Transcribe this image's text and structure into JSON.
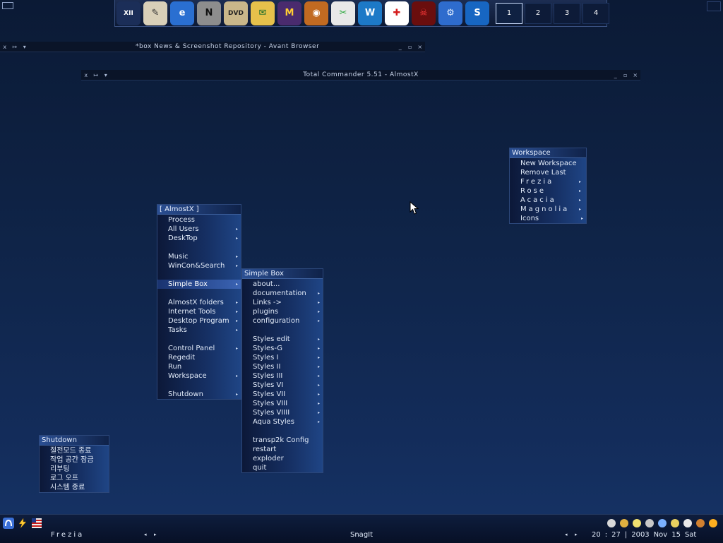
{
  "top_dock": {
    "icons": [
      {
        "name": "clock-icon",
        "glyph": "XII",
        "bg": "#1b2e58",
        "fg": "#ffffff"
      },
      {
        "name": "notepad-icon",
        "glyph": "✎",
        "bg": "#d9d0b8",
        "fg": "#333333"
      },
      {
        "name": "internet-explorer-icon",
        "glyph": "e",
        "bg": "#2a6fd1",
        "fg": "#ffffff"
      },
      {
        "name": "netscape-icon",
        "glyph": "N",
        "bg": "#8d8d8d",
        "fg": "#111111"
      },
      {
        "name": "dvd-icon",
        "glyph": "DVD",
        "bg": "#c9b78a",
        "fg": "#222222"
      },
      {
        "name": "paint-icon",
        "glyph": "✉",
        "bg": "#e6c14b",
        "fg": "#1a6b2a"
      },
      {
        "name": "mire-icon",
        "glyph": "M",
        "bg": "#4a2b6e",
        "fg": "#ffcc33"
      },
      {
        "name": "media-player-icon",
        "glyph": "◉",
        "bg": "#c16a21",
        "fg": "#ffffff"
      },
      {
        "name": "winamp-icon",
        "glyph": "✂",
        "bg": "#e8e8e8",
        "fg": "#28a83a"
      },
      {
        "name": "word-icon",
        "glyph": "W",
        "bg": "#1d79c7",
        "fg": "#ffffff"
      },
      {
        "name": "first-aid-icon",
        "glyph": "✚",
        "bg": "#ffffff",
        "fg": "#d41c1c"
      },
      {
        "name": "darth-maul-icon",
        "glyph": "☠",
        "bg": "#6a0e0e",
        "fg": "#ff3b3b"
      },
      {
        "name": "settings-gear-icon",
        "glyph": "⚙",
        "bg": "#2e6ccd",
        "fg": "#e3efff"
      },
      {
        "name": "swirl-icon",
        "glyph": "S",
        "bg": "#1766c2",
        "fg": "#ffffff"
      }
    ],
    "workspaces": [
      "1",
      "2",
      "3",
      "4"
    ],
    "active_workspace": "1"
  },
  "windows": {
    "avant": {
      "title": "*box News & Screenshot Repository - Avant Browser",
      "buttons": [
        "x",
        "↦",
        "▾"
      ],
      "controls": [
        "_",
        "▫",
        "×"
      ]
    },
    "total_commander": {
      "title": "Total Commander 5.51 - AlmostX",
      "buttons": [
        "x",
        "↦",
        "▾"
      ],
      "controls": [
        "_",
        "▫",
        "×"
      ]
    }
  },
  "workspace_menu": {
    "title": "Workspace",
    "items": [
      {
        "label": "New Workspace",
        "arrow": false,
        "spaced": false
      },
      {
        "label": "Remove Last",
        "arrow": false,
        "spaced": false
      },
      {
        "label": "Frezia",
        "arrow": true,
        "spaced": true
      },
      {
        "label": "Rose",
        "arrow": true,
        "spaced": true
      },
      {
        "label": "Acacia",
        "arrow": true,
        "spaced": true
      },
      {
        "label": "Magnolia",
        "arrow": true,
        "spaced": true
      },
      {
        "label": "Icons",
        "arrow": true,
        "spaced": false
      }
    ]
  },
  "almostx_menu": {
    "title": "[ AlmostX ]",
    "items": [
      {
        "label": "Process",
        "arrow": false
      },
      {
        "label": "All Users",
        "arrow": true
      },
      {
        "label": "DeskTop",
        "arrow": true
      },
      {
        "label": "",
        "sep": true
      },
      {
        "label": "Music",
        "arrow": true
      },
      {
        "label": "WinCon&Search",
        "arrow": true
      },
      {
        "label": "",
        "sep": true
      },
      {
        "label": "Simple Box",
        "arrow": true,
        "highlight": true
      },
      {
        "label": "",
        "sep": true
      },
      {
        "label": "AlmostX folders",
        "arrow": true
      },
      {
        "label": "Internet Tools",
        "arrow": true
      },
      {
        "label": "Desktop Program",
        "arrow": true
      },
      {
        "label": "Tasks",
        "arrow": true
      },
      {
        "label": "",
        "sep": true
      },
      {
        "label": "Control Panel",
        "arrow": true
      },
      {
        "label": "Regedit",
        "arrow": false
      },
      {
        "label": "Run",
        "arrow": false
      },
      {
        "label": "Workspace",
        "arrow": true
      },
      {
        "label": "",
        "sep": true
      },
      {
        "label": "Shutdown",
        "arrow": true
      }
    ]
  },
  "simplebox_menu": {
    "title": "Simple Box",
    "items": [
      {
        "label": "about...",
        "arrow": false
      },
      {
        "label": "documentation",
        "arrow": true
      },
      {
        "label": "Links ->",
        "arrow": true
      },
      {
        "label": "plugins",
        "arrow": true
      },
      {
        "label": "configuration",
        "arrow": true
      },
      {
        "label": "",
        "sep": true
      },
      {
        "label": "Styles edit",
        "arrow": true
      },
      {
        "label": "Styles-G",
        "arrow": true
      },
      {
        "label": "Styles I",
        "arrow": true
      },
      {
        "label": "Styles II",
        "arrow": true
      },
      {
        "label": "Styles III",
        "arrow": true
      },
      {
        "label": "Styles VI",
        "arrow": true
      },
      {
        "label": "Styles VII",
        "arrow": true
      },
      {
        "label": "Styles VIII",
        "arrow": true
      },
      {
        "label": "Styles VIIII",
        "arrow": true
      },
      {
        "label": "Aqua Styles",
        "arrow": true
      },
      {
        "label": "",
        "sep": true
      },
      {
        "label": "transp2k Config",
        "arrow": false
      },
      {
        "label": "restart",
        "arrow": false
      },
      {
        "label": "exploder",
        "arrow": false
      },
      {
        "label": "quit",
        "arrow": false
      }
    ]
  },
  "shutdown_menu": {
    "title": "Shutdown",
    "items": [
      {
        "label": "절전모드 종료"
      },
      {
        "label": "작업 공간 잠금"
      },
      {
        "label": "리부팅"
      },
      {
        "label": "로그 오프"
      },
      {
        "label": "시스템 종료"
      }
    ]
  },
  "taskbar": {
    "workspace_name": "Frezia",
    "task_name": "SnagIt",
    "clock": {
      "hour": "20",
      "minute": "27",
      "year": "2003",
      "month": "Nov",
      "day": "15",
      "weekday": "Sat"
    },
    "clock_sep": ":",
    "date_sep": "|",
    "left_icons": [
      "start-icon",
      "lightning-icon",
      "flag-icon"
    ],
    "tray_icons": [
      "pen-icon",
      "recycle-icon",
      "folder-icon",
      "drive-icon",
      "network-icon",
      "tools-icon",
      "key-icon",
      "bottle-icon",
      "sun-icon"
    ]
  }
}
